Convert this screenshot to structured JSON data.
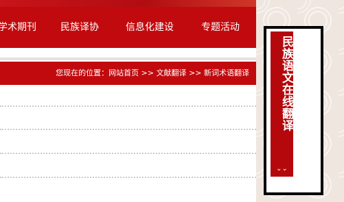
{
  "nav": {
    "items": [
      {
        "label": "学术期刊"
      },
      {
        "label": "民族译协"
      },
      {
        "label": "信息化建设"
      },
      {
        "label": "专题活动"
      }
    ]
  },
  "breadcrumb": {
    "prefix": "您现在的位置：",
    "home": "网站首页",
    "sep": ">>",
    "section": "文献翻译",
    "current": "新词术语翻译"
  },
  "side_panel": {
    "title": "民族语文在线翻译",
    "chevron": "⌄⌄"
  },
  "colors": {
    "brand_red": "#c10a0e",
    "side_red": "#b5080d"
  }
}
